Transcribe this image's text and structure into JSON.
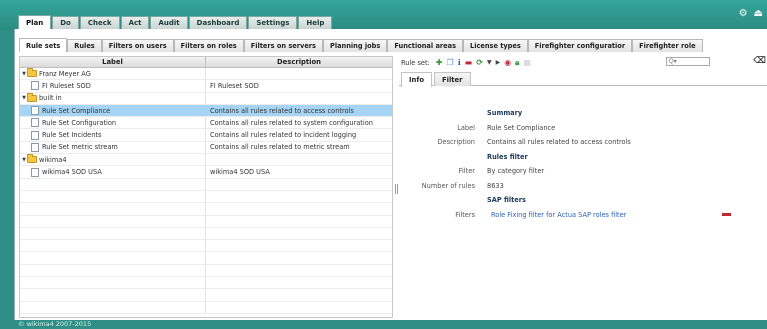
{
  "main_tabs": [
    "Plan",
    "Do",
    "Check",
    "Act",
    "Audit",
    "Dashboard",
    "Settings",
    "Help"
  ],
  "top_icons": {
    "settings": "⚙",
    "logout": "⏏"
  },
  "sub_tabs": [
    "Rule sets",
    "Rules",
    "Filters on users",
    "Filters on roles",
    "Filters on servers",
    "Planning jobs",
    "Functional areas",
    "License types",
    "Firefighter configuratior",
    "Firefighter role"
  ],
  "grid": {
    "headers": {
      "label": "Label",
      "description": "Description"
    },
    "rows": [
      {
        "label": "Franz Meyer AG",
        "description": "",
        "type": "folder",
        "level": 0
      },
      {
        "label": "FI Ruleset SOD",
        "description": "FI Ruleset SOD",
        "type": "item",
        "level": 1
      },
      {
        "label": "built in",
        "description": "",
        "type": "folder",
        "level": 0
      },
      {
        "label": "Rule Set Compliance",
        "description": "Contains all rules related to access controls",
        "type": "item",
        "level": 1,
        "selected": true
      },
      {
        "label": "Rule Set Configuration",
        "description": "Contains all rules related to system configuration",
        "type": "item",
        "level": 1
      },
      {
        "label": "Rule Set Incidents",
        "description": "Contains all rules related to incident logging",
        "type": "item",
        "level": 1
      },
      {
        "label": "Rule Set metric stream",
        "description": "Contains all rules related to metric stream",
        "type": "item",
        "level": 1
      },
      {
        "label": "wikima4",
        "description": "",
        "type": "folder",
        "level": 0
      },
      {
        "label": "wikima4 SOD USA",
        "description": "wikima4 SOD USA",
        "type": "item",
        "level": 1
      },
      {
        "label": "",
        "description": "",
        "type": "empty"
      },
      {
        "label": "",
        "description": "",
        "type": "empty"
      },
      {
        "label": "",
        "description": "",
        "type": "empty"
      },
      {
        "label": "",
        "description": "",
        "type": "empty"
      },
      {
        "label": "",
        "description": "",
        "type": "empty"
      },
      {
        "label": "",
        "description": "",
        "type": "empty"
      },
      {
        "label": "",
        "description": "",
        "type": "empty"
      },
      {
        "label": "",
        "description": "",
        "type": "empty"
      },
      {
        "label": "",
        "description": "",
        "type": "empty"
      },
      {
        "label": "",
        "description": "",
        "type": "empty"
      },
      {
        "label": "",
        "description": "",
        "type": "empty"
      }
    ]
  },
  "toolbar": {
    "label": "Rule set:",
    "search_placeholder": "Q▾",
    "clear_icon": "⌫"
  },
  "detail_tabs": [
    "Info",
    "Filter"
  ],
  "details": {
    "summary_heading": "Summary",
    "label_key": "Label",
    "label_value": "Rule Set Compliance",
    "description_key": "Description",
    "description_value": "Contains all rules related to access controls",
    "rules_filter_heading": "Rules filter",
    "filter_key": "Filter",
    "filter_value": "By category filter",
    "number_key": "Number of rules",
    "number_value": "8633",
    "sap_heading": "SAP filters",
    "filters_key": "Filters",
    "filters_value": "Role Fixing filter for Actua SAP roles filter"
  },
  "footer": "© wikima4 2007-2015",
  "colors": {
    "accent": "#2f8f86",
    "selected_row": "#a6d4f5",
    "link": "#2b62b6",
    "remove": "#c1272d"
  }
}
